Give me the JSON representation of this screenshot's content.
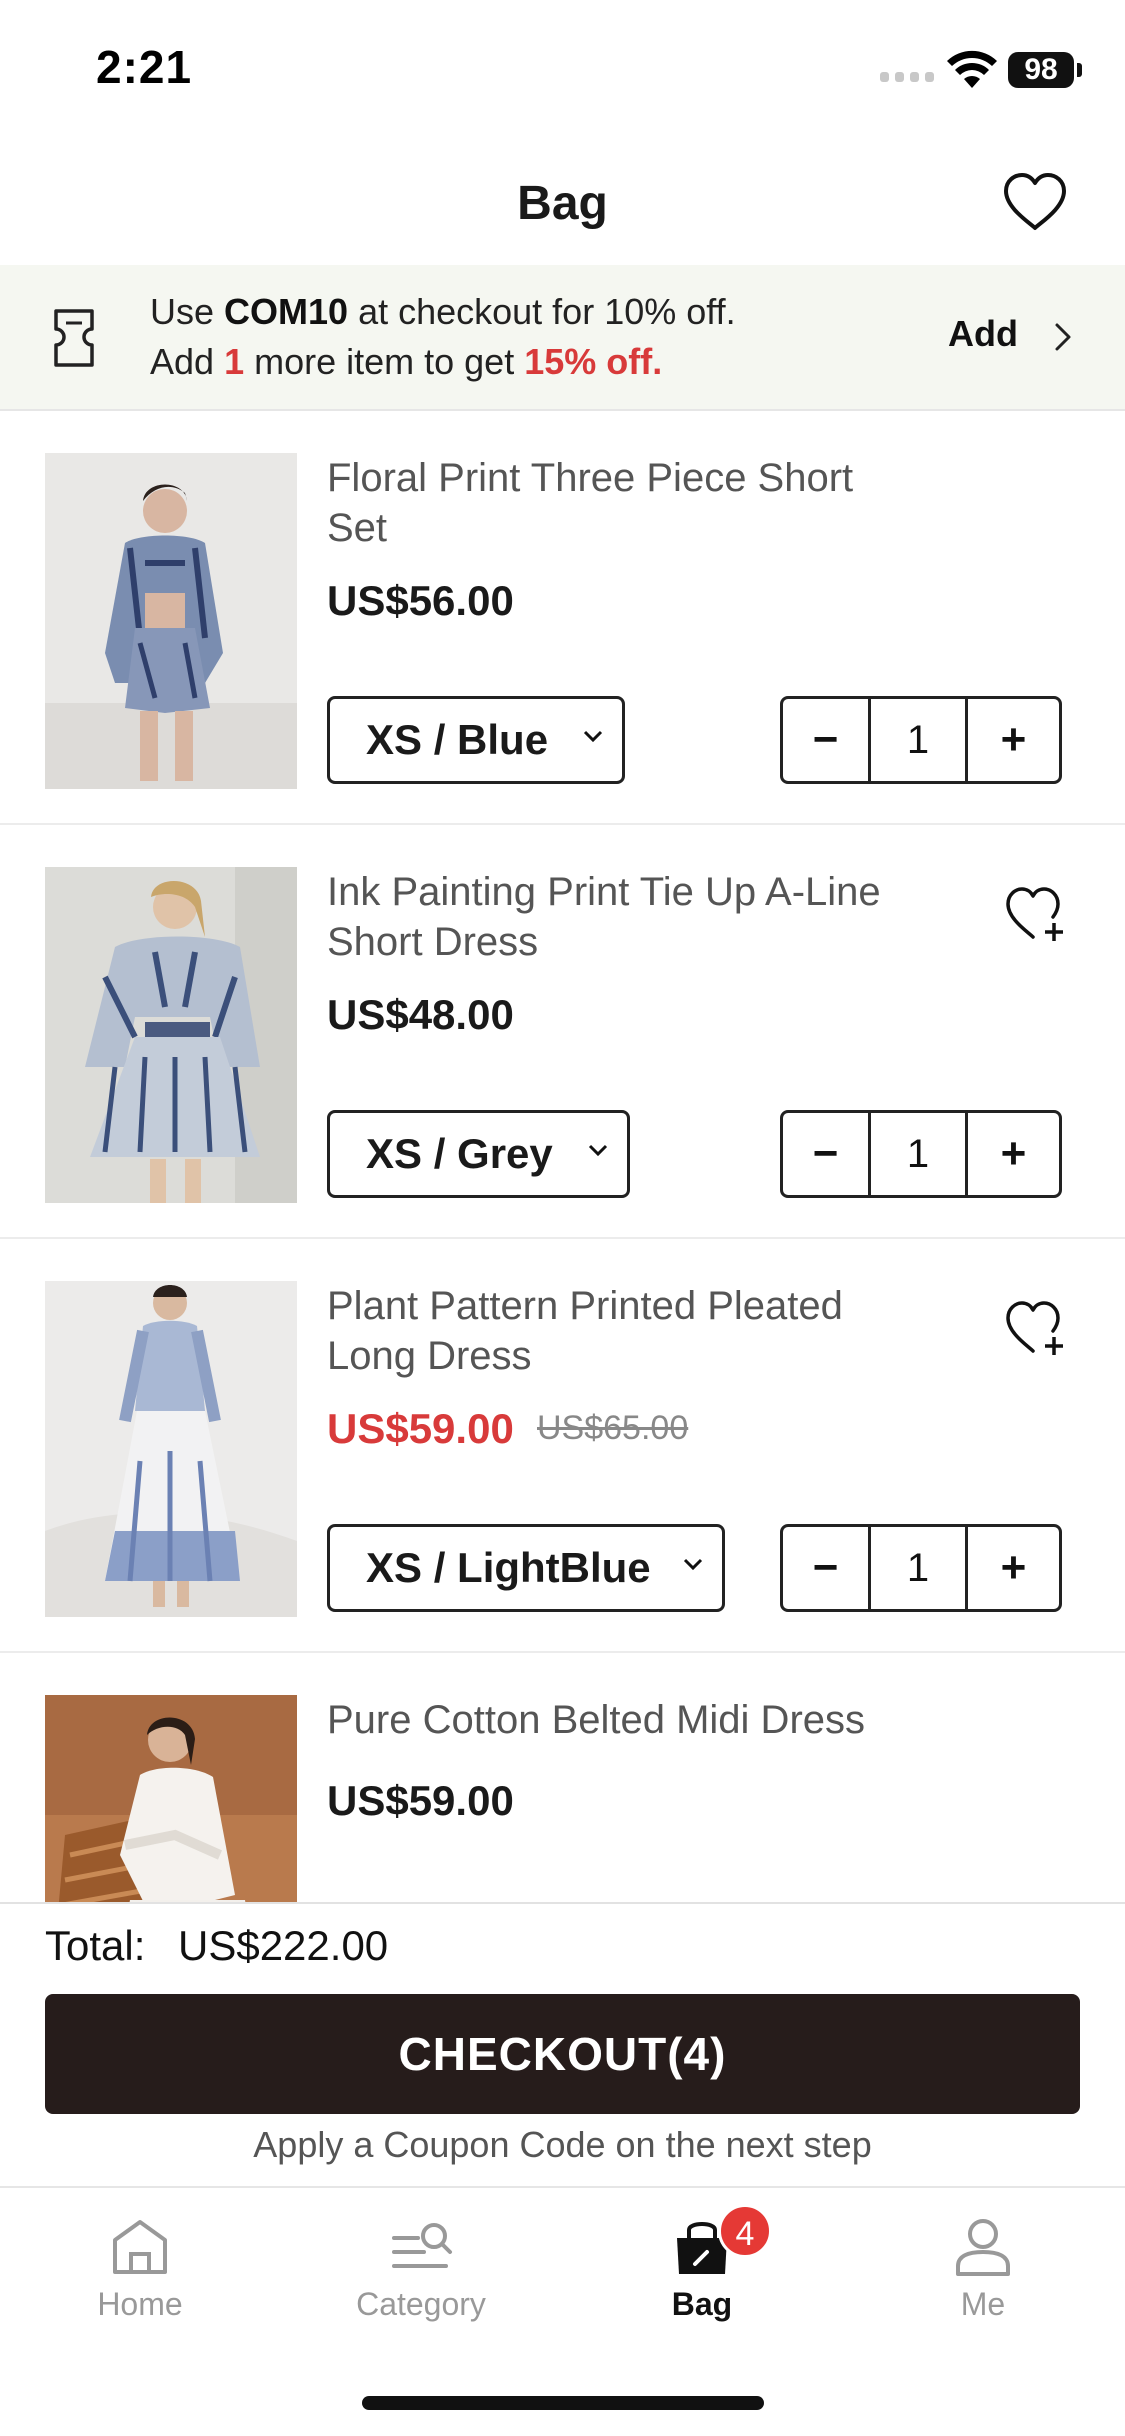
{
  "status_bar": {
    "time": "2:21",
    "battery": "98"
  },
  "header": {
    "title": "Bag"
  },
  "promo": {
    "line1_prefix": "Use ",
    "code": "COM10",
    "line1_suffix": " at checkout for 10% off.",
    "line2_prefix": "Add ",
    "count": "1",
    "line2_middle": " more item to get ",
    "discount": "15% off.",
    "action_label": "Add"
  },
  "items": [
    {
      "name": "Floral Print Three Piece Short Set",
      "price": "US$56.00",
      "old_price": "",
      "variant": "XS / Blue",
      "qty": "1"
    },
    {
      "name": "Ink Painting Print Tie Up A-Line Short Dress",
      "price": "US$48.00",
      "old_price": "",
      "variant": "XS / Grey",
      "qty": "1"
    },
    {
      "name": "Plant Pattern Printed Pleated Long Dress",
      "price": "US$59.00",
      "old_price": "US$65.00",
      "variant": "XS / LightBlue",
      "qty": "1"
    },
    {
      "name": "Pure Cotton Belted Midi Dress",
      "price": "US$59.00",
      "old_price": ""
    }
  ],
  "qty_controls": {
    "minus": "−",
    "plus": "+"
  },
  "summary": {
    "total_label": "Total:",
    "total_value": "US$222.00",
    "checkout_label": "CHECKOUT(4)",
    "coupon_hint": "Apply a Coupon Code on the next step"
  },
  "tabbar": {
    "tabs": [
      {
        "label": "Home",
        "icon": "home-icon"
      },
      {
        "label": "Category",
        "icon": "category-icon"
      },
      {
        "label": "Bag",
        "icon": "bag-icon",
        "active": true
      },
      {
        "label": "Me",
        "icon": "person-icon"
      }
    ],
    "bag_badge": "4"
  },
  "colors": {
    "sale": "#d83a3a",
    "checkout_bg": "#261c1b",
    "badge": "#e53935",
    "promo_bg": "#f5f7f1"
  }
}
